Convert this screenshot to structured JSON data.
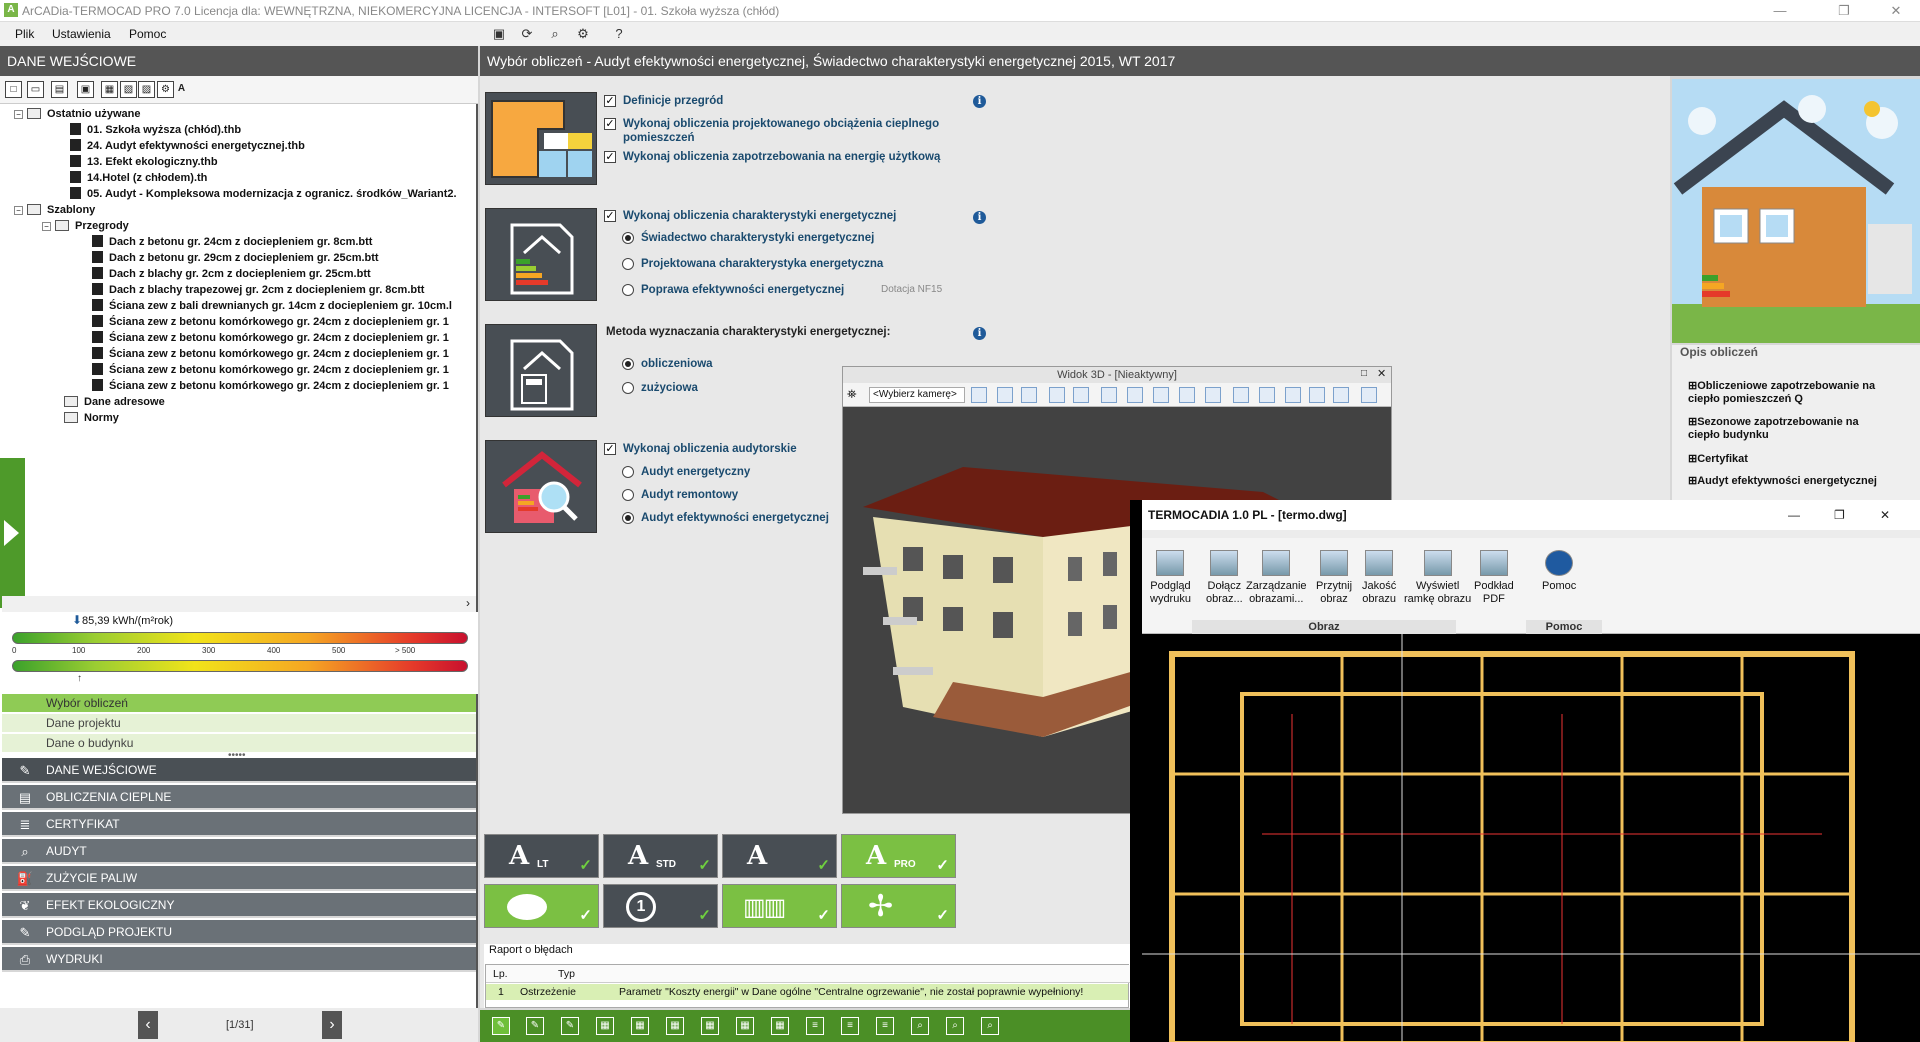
{
  "window": {
    "title": "ArCADia-TERMOCAD PRO 7.0 Licencja dla: WEWNĘTRZNA, NIEKOMERCYJNA LICENCJA - INTERSOFT [L01] - 01. Szkoła wyższa (chłód)",
    "minimize": "—",
    "restore": "❐",
    "close": "✕"
  },
  "menu": [
    "Plik",
    "Ustawienia",
    "Pomoc"
  ],
  "left": {
    "header": "DANE WEJŚCIOWE",
    "tree": {
      "recent_label": "Ostatnio używane",
      "recent": [
        "01. Szkoła wyższa (chłód).thb",
        "24. Audyt efektywności energetycznej.thb",
        "13. Efekt ekologiczny.thb",
        "14.Hotel (z chłodem).th",
        "05. Audyt - Kompleksowa modernizacja z ogranicz. środków_Wariant2."
      ],
      "templates_label": "Szablony",
      "partitions_label": "Przegrody",
      "partitions": [
        "Dach z betonu gr. 24cm z dociepleniem gr. 8cm.btt",
        "Dach z betonu gr. 29cm z dociepleniem gr. 25cm.btt",
        "Dach z blachy gr. 2cm z dociepleniem gr. 25cm.btt",
        "Dach z blachy trapezowej gr. 2cm z dociepleniem gr. 8cm.btt",
        "Ściana zew z bali drewnianych gr. 14cm z dociepleniem gr. 10cm.l",
        "Ściana zew z betonu komórkowego gr. 24cm z dociepleniem gr. 1",
        "Ściana zew z betonu komórkowego gr. 24cm z dociepleniem gr. 1",
        "Ściana zew z betonu komórkowego gr. 24cm z dociepleniem gr. 1",
        "Ściana zew z betonu komórkowego gr. 24cm z dociepleniem gr. 1",
        "Ściana zew z betonu komórkowego gr. 24cm z dociepleniem gr. 1"
      ],
      "address_label": "Dane adresowe",
      "norms_label": "Normy"
    },
    "gauge": {
      "value": "85,39 kWh/(m²rok)",
      "value_numeric": 85.39,
      "ticks": [
        "0",
        "100",
        "200",
        "300",
        "400",
        "500",
        "> 500"
      ],
      "ticks2": [
        "0",
        "100",
        "200",
        "300",
        "400",
        "500",
        "> 500"
      ]
    },
    "subnav": [
      "Wybór obliczeń",
      "Dane projektu",
      "Dane o budynku"
    ],
    "mainnav": [
      "DANE WEJŚCIOWE",
      "OBLICZENIA CIEPLNE",
      "CERTYFIKAT",
      "AUDYT",
      "ZUŻYCIE PALIW",
      "EFEKT EKOLOGICZNY",
      "PODGLĄD PROJEKTU",
      "WYDRUKI"
    ],
    "pager": {
      "prev": "‹",
      "next": "›",
      "text": "[1/31]"
    }
  },
  "main": {
    "header": "Wybór obliczeń - Audyt efektywności energetycznej, Świadectwo charakterystyki energetycznej 2015, WT 2017",
    "group1": [
      "Definicje przegród",
      "Wykonaj obliczenia projektowanego obciążenia cieplnego",
      "pomieszczeń",
      "Wykonaj obliczenia zapotrzebowania na energię użytkową"
    ],
    "group2": {
      "check": "Wykonaj obliczenia charakterystyki energetycznej",
      "options": [
        "Świadectwo charakterystyki energetycznej",
        "Projektowana charakterystyka energetyczna",
        "Poprawa efektywności energetycznej"
      ],
      "note": "Dotacja NF15"
    },
    "group3": {
      "label": "Metoda wyznaczania charakterystyki energetycznej:",
      "options": [
        "obliczeniowa",
        "zużyciowa"
      ]
    },
    "group4": {
      "check": "Wykonaj obliczenia audytorskie",
      "options": [
        "Audyt energetyczny",
        "Audyt remontowy",
        "Audyt efektywności energetycznej"
      ]
    },
    "info": "i"
  },
  "opis": {
    "title": "Opis obliczeń",
    "items": [
      "Obliczeniowe zapotrzebowanie na ciepło pomieszczeń Q",
      "Sezonowe zapotrzebowanie na ciepło budynku",
      "Certyfikat",
      "Audyt efektywności energetycznej"
    ]
  },
  "view3d": {
    "title": "Widok 3D - [Nieaktywny]",
    "camera": "<Wybierz kamerę>"
  },
  "cad": {
    "title": "TERMOCADIA 1.0 PL - [termo.dwg]",
    "buttons": [
      [
        "Podgląd",
        "wydruku"
      ],
      [
        "Dołącz",
        "obraz..."
      ],
      [
        "Zarządzanie",
        "obrazami..."
      ],
      [
        "Przytnij",
        "obraz"
      ],
      [
        "Jakość",
        "obrazu"
      ],
      [
        "Wyświetl",
        "ramkę obrazu"
      ],
      [
        "Podkład",
        "PDF"
      ],
      [
        "Pomoc",
        ""
      ]
    ],
    "groups": [
      "Obraz",
      "Pomoc"
    ],
    "controls": [
      "—",
      "❐",
      "✕"
    ]
  },
  "apps": [
    {
      "big": "A",
      "sub": "LT"
    },
    {
      "big": "A",
      "sub": "STD"
    },
    {
      "big": "A",
      "sub": ""
    },
    {
      "big": "A",
      "sub": "PRO"
    }
  ],
  "raport": {
    "title": "Raport o błędach",
    "headers": [
      "Lp.",
      "Typ"
    ],
    "rows": [
      [
        "1",
        "Ostrzeżenie",
        "Parametr \"Koszty energii\" w Dane ogólne \"Centralne ogrzewanie\", nie został poprawnie wypełniony!"
      ]
    ]
  },
  "colors": {
    "accent_green": "#4e9a2a",
    "header_gray": "#555555",
    "nav_gray": "#6a7177",
    "link_blue": "#1a4a6e"
  }
}
